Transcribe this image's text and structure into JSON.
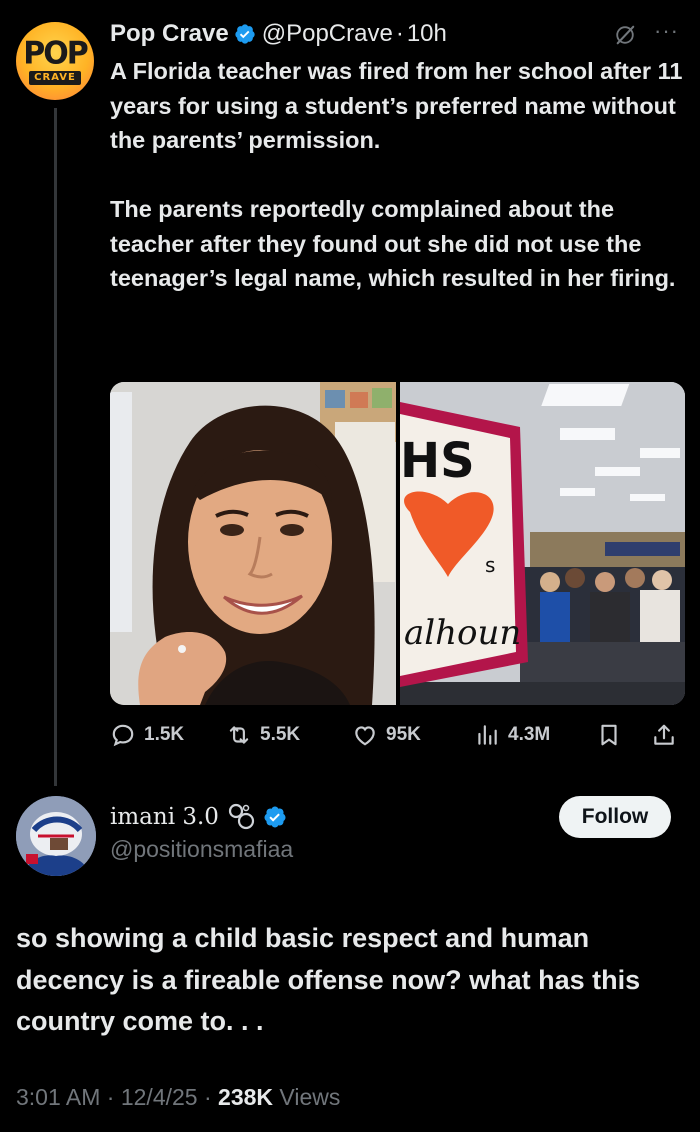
{
  "parent_tweet": {
    "avatar": {
      "logo_main": "POP",
      "logo_sub": "CRAVE"
    },
    "author_name": "Pop Crave",
    "handle": "@PopCrave",
    "separator": "·",
    "time": "10h",
    "verified_color": "#1d9bf0",
    "text_paragraph_1": "A Florida teacher was fired from her school after 11 years for using a student’s preferred name without the parents’ permission.",
    "text_paragraph_2": "The parents reportedly complained about the teacher after they found out she did not use the teenager’s legal name, which resulted in her firing.",
    "media": {
      "image_right_sign_text_top": "HS",
      "image_right_sign_text_mid": "s",
      "image_right_sign_text_bottom": "alhoun"
    },
    "stats": {
      "replies": "1.5K",
      "reposts": "5.5K",
      "likes": "95K",
      "views": "4.3M"
    },
    "icons": [
      "grok-icon",
      "more-icon",
      "reply-icon",
      "repost-icon",
      "like-icon",
      "views-icon",
      "bookmark-icon",
      "share-icon"
    ]
  },
  "reply_tweet": {
    "author_name": "imani 3.0",
    "handle": "@positionsmafiaa",
    "follow_label": "Follow",
    "text": "so showing a child basic respect and human decency is a fireable offense now? what has this country come to. . .",
    "meta": {
      "time": "3:01 AM",
      "sep1": "·",
      "date": "12/4/25",
      "sep2": "·",
      "views_count": "238K",
      "views_label": "Views"
    }
  },
  "colors": {
    "background": "#000000",
    "text_primary": "#e7e9ea",
    "text_secondary": "#71767b",
    "verified_blue": "#1d9bf0",
    "follow_button_bg": "#eff3f4"
  }
}
